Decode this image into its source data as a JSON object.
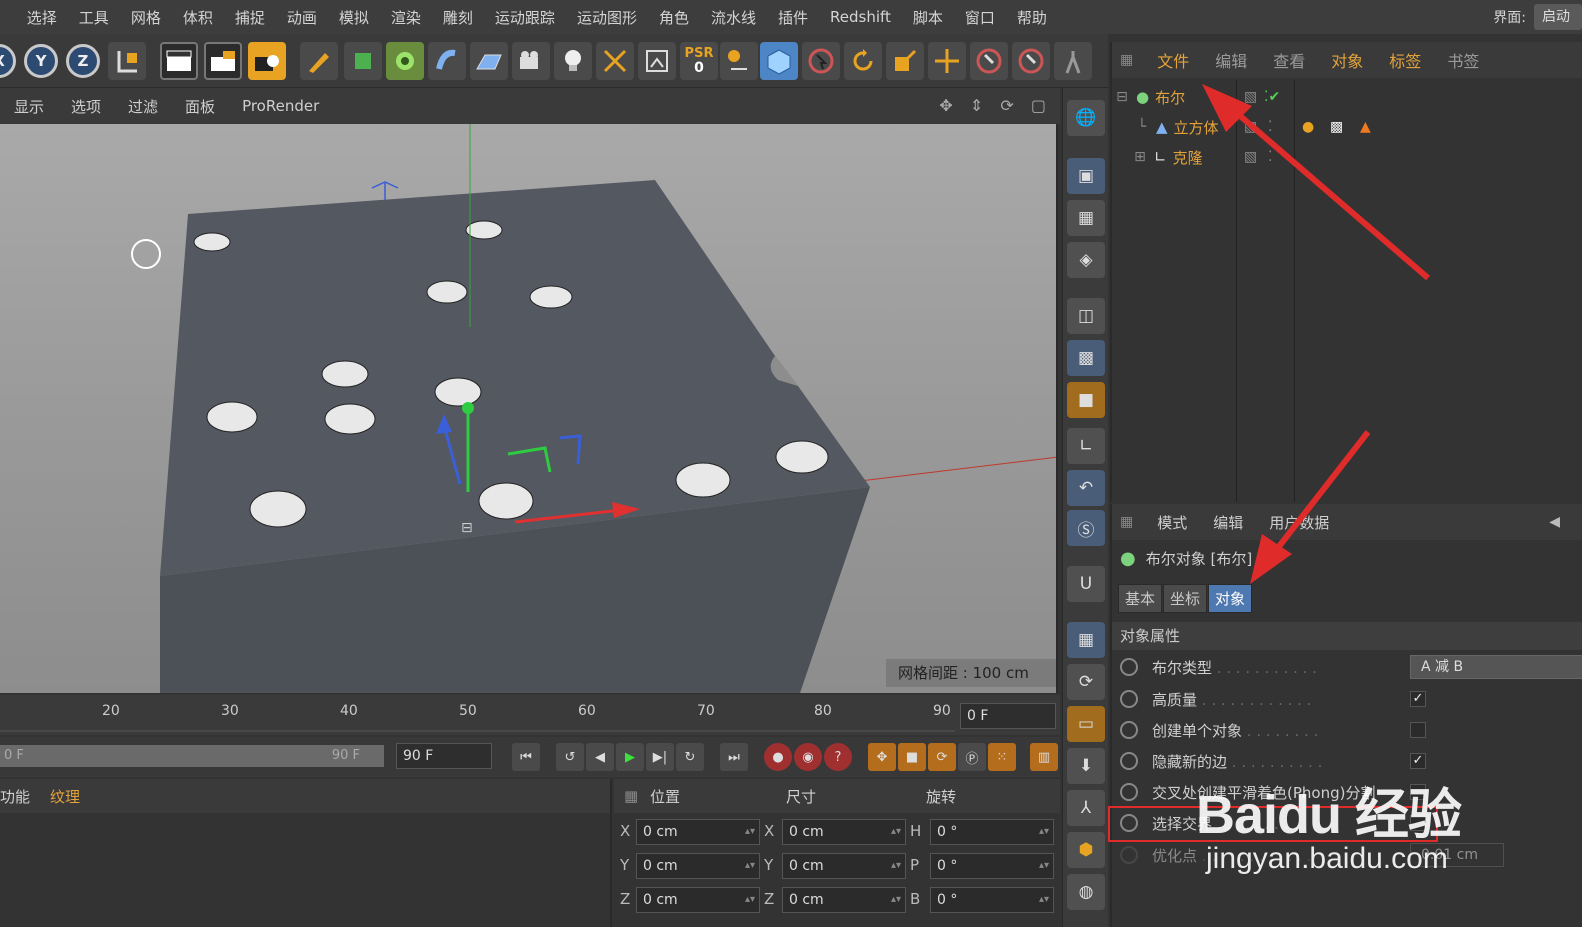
{
  "menubar": {
    "items": [
      "选择",
      "工具",
      "网格",
      "体积",
      "捕捉",
      "动画",
      "模拟",
      "渲染",
      "雕刻",
      "运动跟踪",
      "运动图形",
      "角色",
      "流水线",
      "插件",
      "Redshift",
      "脚本",
      "窗口",
      "帮助"
    ],
    "interface_label": "界面:",
    "interface_value": "启动"
  },
  "toolbar": {
    "axis_x": "X",
    "axis_y": "Y",
    "axis_z": "Z",
    "psr_label": "PSR",
    "psr_value": "0"
  },
  "viewport_menu": {
    "items": [
      "显示",
      "选项",
      "过滤",
      "面板",
      "ProRender"
    ]
  },
  "viewport": {
    "grid_info": "网格间距 : 100 cm"
  },
  "object_manager": {
    "menu": [
      "文件",
      "编辑",
      "查看",
      "对象",
      "标签",
      "书签"
    ],
    "objects": [
      {
        "name": "布尔"
      },
      {
        "name": "立方体"
      },
      {
        "name": "克隆"
      }
    ]
  },
  "attribute_manager": {
    "menu": [
      "模式",
      "编辑",
      "用户数据"
    ],
    "object_title": "布尔对象 [布尔]",
    "tabs": [
      "基本",
      "坐标",
      "对象"
    ],
    "active_tab": "对象",
    "section": "对象属性",
    "properties": [
      {
        "label": "布尔类型",
        "type": "dropdown",
        "value": "A 减 B"
      },
      {
        "label": "高质量",
        "type": "check",
        "checked": true
      },
      {
        "label": "创建单个对象",
        "type": "check",
        "checked": false
      },
      {
        "label": "隐藏新的边",
        "type": "check",
        "checked": true
      },
      {
        "label": "交叉处创建平滑着色(Phong)分割",
        "type": "check",
        "checked": false
      },
      {
        "label": "选择交界",
        "type": "check",
        "checked": false
      },
      {
        "label": "优化点",
        "type": "field",
        "value": "0.01 cm"
      }
    ]
  },
  "timeline": {
    "ticks": [
      "20",
      "30",
      "40",
      "50",
      "60",
      "70",
      "80",
      "90"
    ],
    "current_frame": "0 F"
  },
  "transport": {
    "range_start": "0 F",
    "range_end": "90 F",
    "end_field": "90 F"
  },
  "material_panel": {
    "menu": [
      "功能",
      "纹理"
    ]
  },
  "coordinates": {
    "headers": [
      "位置",
      "尺寸",
      "旋转"
    ],
    "rows": [
      {
        "axis": "X",
        "pos": "0 cm",
        "size_axis": "X",
        "size": "0 cm",
        "rot_axis": "H",
        "rot": "0 °"
      },
      {
        "axis": "Y",
        "pos": "0 cm",
        "size_axis": "Y",
        "size": "0 cm",
        "rot_axis": "P",
        "rot": "0 °"
      },
      {
        "axis": "Z",
        "pos": "0 cm",
        "size_axis": "Z",
        "size": "0 cm",
        "rot_axis": "B",
        "rot": "0 °"
      }
    ]
  },
  "watermark": {
    "brand": "Baidu 经验",
    "url": "jingyan.baidu.com"
  },
  "colors": {
    "accent_orange": "#e3a33a",
    "annotation_red": "#e02b2b",
    "active_tab_blue": "#4e78b0"
  }
}
